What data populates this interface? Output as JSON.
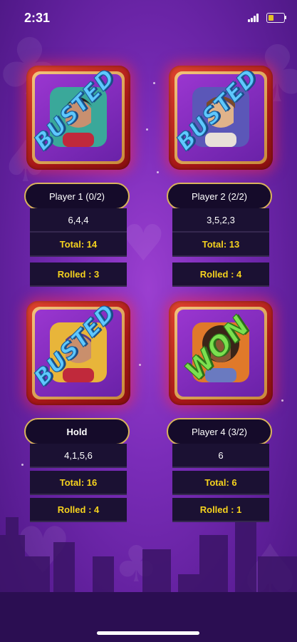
{
  "status_bar": {
    "time": "2:31",
    "battery_level": 0.35
  },
  "players": [
    {
      "name": "Player 1 (0/2)",
      "rolls": "6,4,4",
      "total": "Total: 14",
      "rolled": "Rolled : 3",
      "stamp": "BUSTED",
      "result": "busted",
      "avatar_color": "#3aa89a"
    },
    {
      "name": "Player 2 (2/2)",
      "rolls": "3,5,2,3",
      "total": "Total: 13",
      "rolled": "Rolled : 4",
      "stamp": "BUSTED",
      "result": "busted",
      "avatar_color": "#5b57b8"
    },
    {
      "name": "Hold",
      "rolls": "4,1,5,6",
      "total": "Total: 16",
      "rolled": "Rolled : 4",
      "stamp": "BUSTED",
      "result": "busted",
      "avatar_color": "#e8b53a"
    },
    {
      "name": "Player 4 (3/2)",
      "rolls": "6",
      "total": "Total: 6",
      "rolled": "Rolled : 1",
      "stamp": "WON",
      "result": "won",
      "avatar_color": "#e0792a"
    }
  ],
  "colors": {
    "accent_gold": "#f5d21e",
    "busted_blue": "#5ec8ff",
    "won_green": "#7be04f",
    "frame_red": "#c42222"
  }
}
